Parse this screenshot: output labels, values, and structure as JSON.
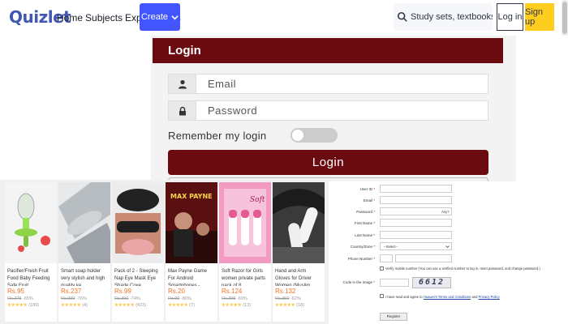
{
  "header": {
    "logo": "Quizlet",
    "nav": [
      "Home",
      "Subjects",
      "Explanations"
    ],
    "create_label": "Create",
    "search_placeholder": "Study sets, textbooks, ...",
    "login_label": "Log in",
    "signup_label": "Sign up",
    "accent_color": "#4255ff"
  },
  "login_panel": {
    "title": "Login",
    "email_placeholder": "Email",
    "password_placeholder": "Password",
    "remember_label": "Remember my login",
    "remember_enabled": false,
    "submit_label": "Login",
    "brand_color": "#6b0b0f"
  },
  "products": [
    {
      "title": "Pacifier/Fresh Fruit Food Baby Feeding Safe Fruit...",
      "price": "Rs.95",
      "old_price": "Rs.275",
      "discount": "-65%",
      "stars": "★★★★★",
      "reviews": "(189)"
    },
    {
      "title": "Smart soap holder very stylish and high quality ke...",
      "price": "Rs.237",
      "old_price": "Rs.999",
      "discount": "-76%",
      "stars": "★★★★★",
      "reviews": "(4)"
    },
    {
      "title": "Pack of 2 - Sleeping Nap Eye Mask Eye Shade Cove...",
      "price": "Rs.99",
      "old_price": "Rs.390",
      "discount": "-74%",
      "stars": "★★★★★",
      "reviews": "(423)"
    },
    {
      "title": "Max Payne Game For Android Smartphones -...",
      "price": "Rs.20",
      "old_price": "Rs.99",
      "discount": "-80%",
      "stars": "★★★★★",
      "reviews": "(7)"
    },
    {
      "title": "Soft Razor for Girls women private parts pack of 8",
      "price": "Rs.124",
      "old_price": "Rs.399",
      "discount": "-69%",
      "stars": "★★★★★",
      "reviews": "(13)"
    },
    {
      "title": "Hand and Arm Gloves for Driver Women (Muslim...",
      "price": "Rs.132",
      "old_price": "Rs.350",
      "discount": "-62%",
      "stars": "★★★★★",
      "reviews": "(18)"
    }
  ],
  "registration": {
    "fields": [
      {
        "label": "User ID",
        "required": "*"
      },
      {
        "label": "Email",
        "required": "*"
      },
      {
        "label": "Password",
        "required": "*"
      },
      {
        "label": "First Name",
        "required": "*"
      },
      {
        "label": "Last Name",
        "required": "*"
      },
      {
        "label": "Country/Zone",
        "required": "*"
      },
      {
        "label": "Phone Number",
        "required": "*"
      },
      {
        "label": "Code in the image",
        "required": "*"
      }
    ],
    "country_value": "--Select--",
    "password_hint": "Any?",
    "verify_note": "Verify mobile number (You can use a verified number to log in, reset password, and change password.)",
    "captcha_text": "6612",
    "terms_prefix": "I have read and agree to",
    "terms_link": "Huawei's Terms and Conditions",
    "terms_and": "and",
    "privacy_link": "Privacy Policy",
    "register_label": "Register"
  }
}
